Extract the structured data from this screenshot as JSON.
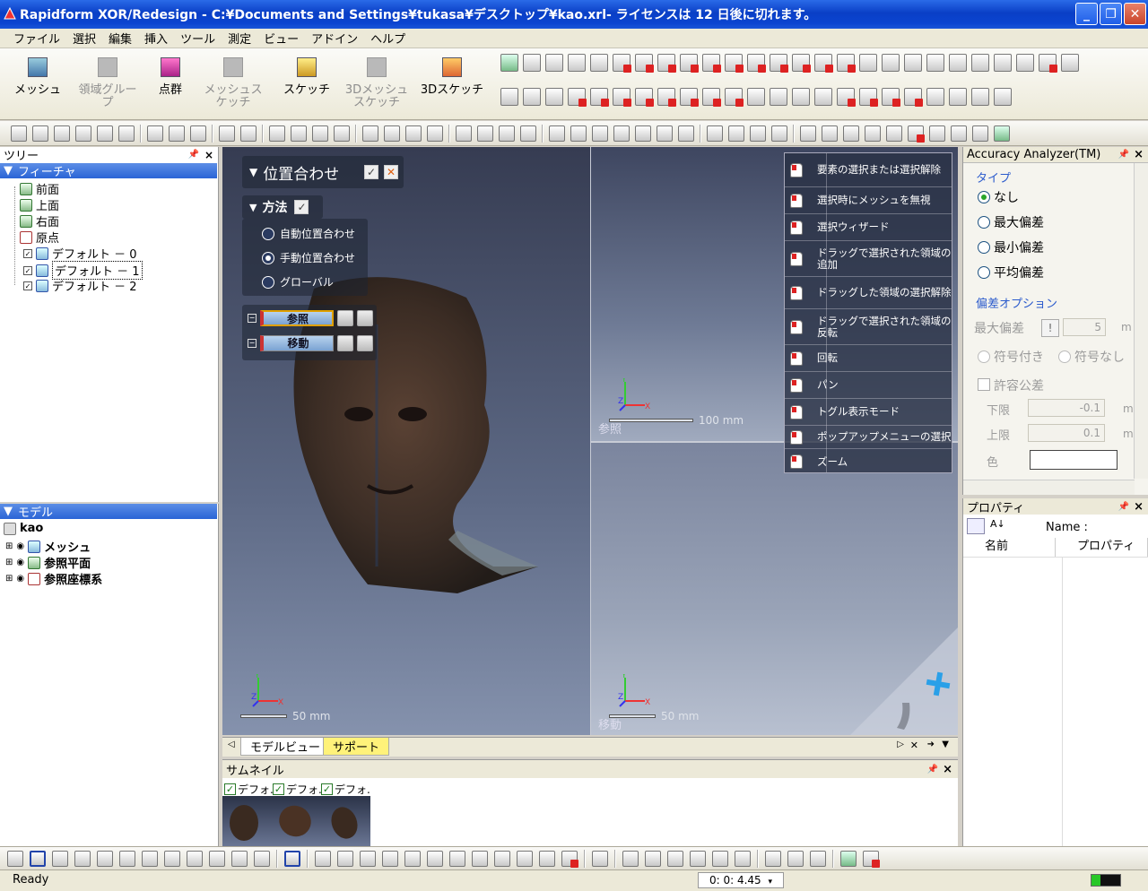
{
  "window": {
    "title": "Rapidform XOR/Redesign - C:¥Documents and Settings¥tukasa¥デスクトップ¥kao.xrl- ライセンスは 12 日後に切れます。",
    "minimize": "_",
    "maximize": "❐",
    "close": "✕"
  },
  "menu": [
    "ファイル",
    "選択",
    "編集",
    "挿入",
    "ツール",
    "測定",
    "ビュー",
    "アドイン",
    "ヘルプ"
  ],
  "ribbon": {
    "buttons": [
      {
        "label": "メッシュ",
        "enabled": true
      },
      {
        "label": "領域グループ",
        "enabled": false
      },
      {
        "label": "点群",
        "enabled": true
      },
      {
        "label": "メッシュスケッチ",
        "enabled": false
      },
      {
        "label": "スケッチ",
        "enabled": true
      },
      {
        "label": "3Dメッシュスケッチ",
        "enabled": false
      },
      {
        "label": "3Dスケッチ",
        "enabled": true
      }
    ]
  },
  "tree": {
    "header": "ツリー",
    "section": "フィーチャ",
    "items": [
      "前面",
      "上面",
      "右面",
      "原点",
      "デフォルト － 0",
      "デフォルト － 1",
      "デフォルト － 2"
    ]
  },
  "model": {
    "section": "モデル",
    "root": "kao",
    "items": [
      "メッシュ",
      "参照平面",
      "参照座標系"
    ]
  },
  "alignment": {
    "title": "位置合わせ",
    "method_title": "方法",
    "options": [
      {
        "label": "自動位置合わせ",
        "selected": false
      },
      {
        "label": "手動位置合わせ",
        "selected": true
      },
      {
        "label": "グローバル",
        "selected": false
      }
    ],
    "reference_label": "参照",
    "moving_label": "移動"
  },
  "views": {
    "left_scale": "50 mm",
    "ref_scale": "100 mm",
    "ref_label": "参照",
    "mov_scale": "50 mm",
    "mov_label": "移動",
    "axis_x": "X",
    "axis_y": "Y",
    "axis_z": "Z"
  },
  "mouse_help": [
    "要素の選択または選択解除",
    "選択時にメッシュを無視",
    "選択ウィザード",
    "ドラッグで選択された領域の追加",
    "ドラッグした領域の選択解除",
    "ドラッグで選択された領域の反転",
    "回転",
    "パン",
    "トグル表示モード",
    "ポップアップメニューの選択",
    "ズーム"
  ],
  "view_tabs": {
    "model": "モデルビュー",
    "support": "サポート"
  },
  "thumbnails": {
    "header": "サムネイル",
    "items": [
      "デフォ.",
      "デフォ.",
      "デフォ."
    ]
  },
  "accuracy": {
    "header": "Accuracy Analyzer(TM)",
    "type_section": "タイプ",
    "types": [
      {
        "label": "なし",
        "selected": true
      },
      {
        "label": "最大偏差",
        "selected": false
      },
      {
        "label": "最小偏差",
        "selected": false
      },
      {
        "label": "平均偏差",
        "selected": false
      }
    ],
    "deviation_section": "偏差オプション",
    "max_dev_label": "最大偏差",
    "max_dev_value": "5",
    "max_dev_unit": "m",
    "signed": "符号付き",
    "unsigned": "符号なし",
    "tolerance_label": "許容公差",
    "lower_label": "下限",
    "lower_value": "-0.1",
    "upper_label": "上限",
    "upper_value": "0.1",
    "unit": "mm",
    "color_label": "色"
  },
  "properties": {
    "header": "プロパティ",
    "name_label": "Name :",
    "col_name": "名前",
    "col_prop": "プロパティ"
  },
  "status": {
    "text": "Ready",
    "timer": "0: 0: 4.45"
  },
  "colors": {
    "title_bar": "#0a3fc6",
    "section_blue": "#2a64d6",
    "accent_green": "#28c728",
    "support_tab": "#fff27a"
  }
}
